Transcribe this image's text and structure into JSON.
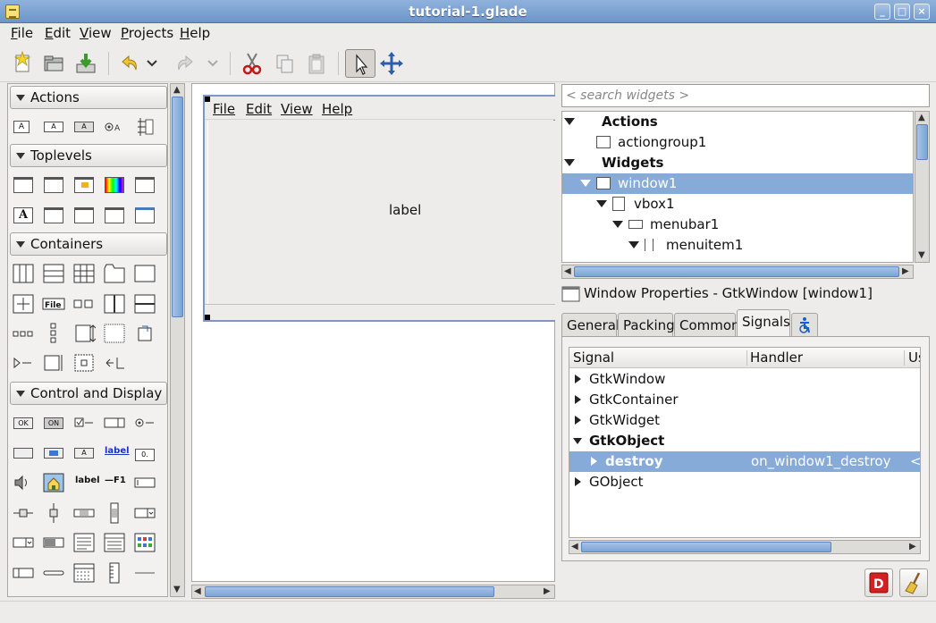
{
  "window": {
    "title": "tutorial-1.glade"
  },
  "menubar": [
    {
      "label": "File",
      "mnemonic": "F",
      "rest": "ile"
    },
    {
      "label": "Edit",
      "mnemonic": "E",
      "rest": "dit"
    },
    {
      "label": "View",
      "mnemonic": "V",
      "rest": "iew"
    },
    {
      "label": "Projects",
      "mnemonic": "P",
      "rest": "rojects"
    },
    {
      "label": "Help",
      "mnemonic": "H",
      "rest": "elp"
    }
  ],
  "toolbar": {
    "icons": [
      "new-icon",
      "open-icon",
      "save-icon",
      "undo-icon",
      "undo-history-icon",
      "redo-icon",
      "redo-history-icon",
      "cut-icon",
      "copy-icon",
      "paste-icon",
      "select-pointer-icon",
      "drag-resize-icon"
    ]
  },
  "palette": {
    "groups": [
      {
        "name": "Actions"
      },
      {
        "name": "Toplevels"
      },
      {
        "name": "Containers"
      },
      {
        "name": "Control and Display"
      }
    ],
    "text_widgets": {
      "file": "File",
      "label_link": "label",
      "label_plain": "label",
      "accel": "—F1",
      "ok": "OK",
      "on": "ON"
    }
  },
  "design": {
    "menus": [
      "File",
      "Edit",
      "View",
      "Help"
    ],
    "label": "label"
  },
  "search": {
    "placeholder": "< search widgets >"
  },
  "tree": {
    "rows": [
      {
        "text": "Actions",
        "bold": true
      },
      {
        "text": "actiongroup1"
      },
      {
        "text": "Widgets",
        "bold": true
      },
      {
        "text": "window1",
        "selected": true
      },
      {
        "text": "vbox1"
      },
      {
        "text": "menubar1"
      },
      {
        "text": "menuitem1"
      }
    ]
  },
  "properties": {
    "title": "Window Properties - GtkWindow [window1]",
    "tabs": [
      {
        "label": "General"
      },
      {
        "label": "Packing"
      },
      {
        "label": "Common"
      },
      {
        "label": "Signals",
        "active": true
      }
    ],
    "columns": {
      "signal": "Signal",
      "handler": "Handler",
      "user": "Us"
    },
    "rows": [
      {
        "signal": "GtkWindow",
        "handler": ""
      },
      {
        "signal": "GtkContainer",
        "handler": ""
      },
      {
        "signal": "GtkWidget",
        "handler": ""
      },
      {
        "signal": "GtkObject",
        "handler": "",
        "bold": true,
        "expanded": true
      },
      {
        "signal": "destroy",
        "handler": "on_window1_destroy",
        "user": "<T",
        "bold": true,
        "selected": true
      },
      {
        "signal": "GObject",
        "handler": ""
      }
    ]
  }
}
